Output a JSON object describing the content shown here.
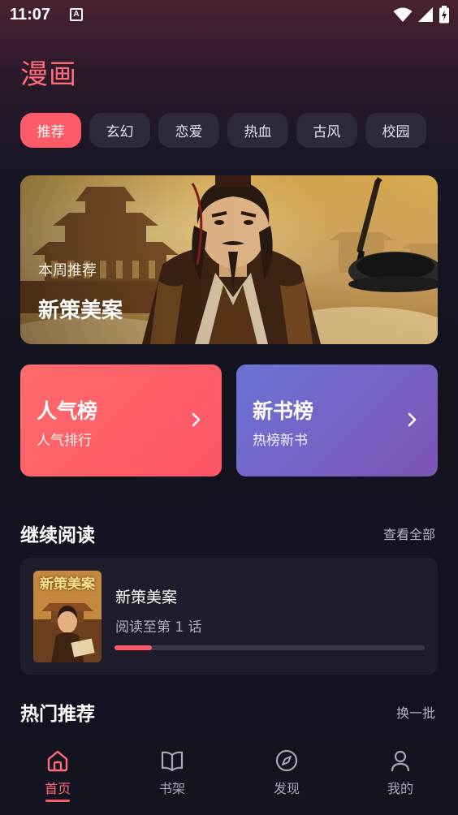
{
  "status_bar": {
    "time": "11:07",
    "app_icon_letter": "A"
  },
  "page_title": "漫画",
  "tabs": [
    {
      "label": "推荐",
      "active": true
    },
    {
      "label": "玄幻",
      "active": false
    },
    {
      "label": "恋爱",
      "active": false
    },
    {
      "label": "热血",
      "active": false
    },
    {
      "label": "古风",
      "active": false
    },
    {
      "label": "校园",
      "active": false
    }
  ],
  "banner": {
    "subtitle": "本周推荐",
    "title": "新策美案"
  },
  "rank_cards": {
    "hot": {
      "title": "人气榜",
      "subtitle": "人气排行"
    },
    "new": {
      "title": "新书榜",
      "subtitle": "热榜新书"
    }
  },
  "continue_reading": {
    "heading": "继续阅读",
    "view_all": "查看全部",
    "book": {
      "title": "新策美案",
      "progress_text": "阅读至第 1 话",
      "cover_text": "新策美案",
      "progress_fraction": 0.12
    }
  },
  "hot_recommend": {
    "heading": "热门推荐",
    "refresh": "换一批"
  },
  "bottom_nav": [
    {
      "label": "首页",
      "icon": "home-icon",
      "active": true
    },
    {
      "label": "书架",
      "icon": "bookshelf-icon",
      "active": false
    },
    {
      "label": "发现",
      "icon": "compass-icon",
      "active": false
    },
    {
      "label": "我的",
      "icon": "user-icon",
      "active": false
    }
  ],
  "colors": {
    "accent": "#ff5a67",
    "title": "#ff6b78",
    "background": "#141320"
  }
}
